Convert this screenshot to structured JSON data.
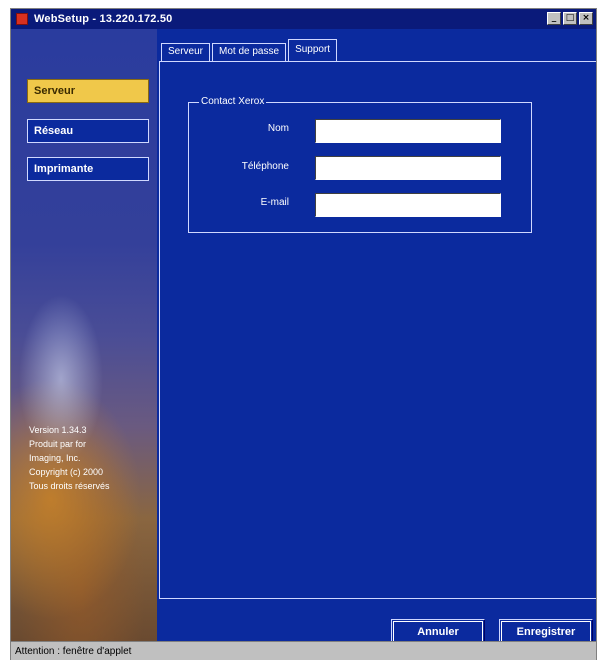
{
  "window": {
    "title": "WebSetup - 13.220.172.50",
    "buttons": {
      "minimize": "_",
      "maximize": "□",
      "close": "×"
    }
  },
  "sidebar": {
    "items": [
      {
        "label": "Serveur",
        "active": true
      },
      {
        "label": "Réseau",
        "active": false
      },
      {
        "label": "Imprimante",
        "active": false
      }
    ],
    "about": [
      "Version 1.34.3",
      "Produit par for",
      "Imaging, Inc.",
      "Copyright (c) 2000",
      "Tous droits réservés"
    ]
  },
  "tabs": [
    {
      "label": "Serveur",
      "active": false
    },
    {
      "label": "Mot de passe",
      "active": false
    },
    {
      "label": "Support",
      "active": true
    }
  ],
  "contact": {
    "legend": "Contact Xerox",
    "fields": [
      {
        "label": "Nom",
        "value": "",
        "placeholder": ""
      },
      {
        "label": "Téléphone",
        "value": "",
        "placeholder": ""
      },
      {
        "label": "E-mail",
        "value": "",
        "placeholder": ""
      }
    ]
  },
  "actions": {
    "cancel": "Annuler",
    "save": "Enregistrer"
  },
  "status": {
    "text": "Attention : fenêtre d'applet"
  },
  "colors": {
    "background": "#0b2a9e",
    "active_item": "#f0c84a",
    "titlebar": "#0a1a7a"
  }
}
